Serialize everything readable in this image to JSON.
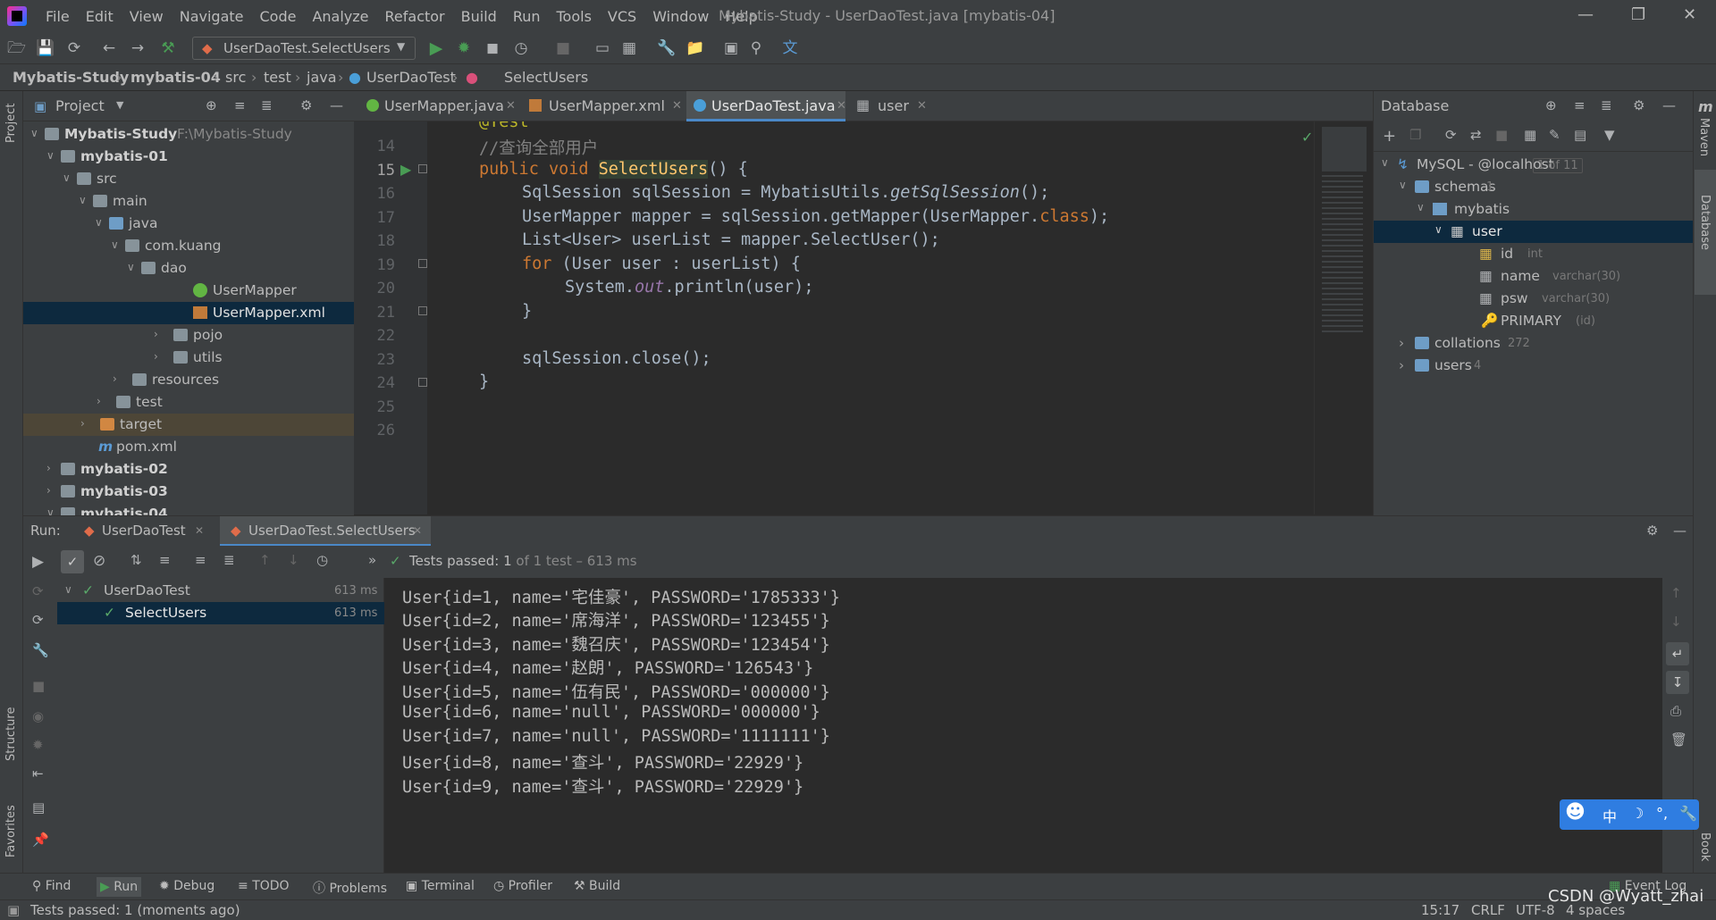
{
  "menubar": {
    "items": [
      "File",
      "Edit",
      "View",
      "Navigate",
      "Code",
      "Analyze",
      "Refactor",
      "Build",
      "Run",
      "Tools",
      "VCS",
      "Window",
      "Help"
    ],
    "title": "Mybatis-Study - UserDaoTest.java [mybatis-04]"
  },
  "toolbar": {
    "run_config": "UserDaoTest.SelectUsers"
  },
  "breadcrumb": [
    "Mybatis-Study",
    "mybatis-04",
    "src",
    "test",
    "java",
    "UserDaoTest",
    "SelectUsers"
  ],
  "project_panel": {
    "title": "Project",
    "tree": [
      {
        "label": "Mybatis-Study",
        "extra": "F:\\Mybatis-Study"
      },
      {
        "label": "mybatis-01"
      },
      {
        "label": "src"
      },
      {
        "label": "main"
      },
      {
        "label": "java"
      },
      {
        "label": "com.kuang"
      },
      {
        "label": "dao"
      },
      {
        "label": "UserMapper"
      },
      {
        "label": "UserMapper.xml"
      },
      {
        "label": "pojo"
      },
      {
        "label": "utils"
      },
      {
        "label": "resources"
      },
      {
        "label": "test"
      },
      {
        "label": "target"
      },
      {
        "label": "pom.xml"
      },
      {
        "label": "mybatis-02"
      },
      {
        "label": "mybatis-03"
      },
      {
        "label": "mybatis-04"
      }
    ]
  },
  "editor_tabs": [
    "UserMapper.java",
    "UserMapper.xml",
    "UserDaoTest.java",
    "user"
  ],
  "editor": {
    "line_numbers": [
      "14",
      "15",
      "16",
      "17",
      "18",
      "19",
      "20",
      "21",
      "22",
      "23",
      "24",
      "25",
      "26"
    ],
    "top_partial": "@Test",
    "line14": "//查询全部用户",
    "l15_kw": "public void ",
    "l15_fn": "SelectUsers",
    "l15_rest": "() {",
    "l16_a": "SqlSession sqlSession = MybatisUtils.",
    "l16_b": "getSqlSession",
    "l16_c": "();",
    "l17_a": "UserMapper mapper = sqlSession.getMapper(UserMapper.",
    "l17_b": "class",
    "l17_c": ");",
    "l18": "List<User> userList = mapper.SelectUser();",
    "l19_kw": "for",
    "l19_rest": " (User user : userList) {",
    "l20_a": "System.",
    "l20_b": "out",
    "l20_c": ".println(user);",
    "l21": "}",
    "l23": "sqlSession.close();",
    "l24": "}"
  },
  "database_panel": {
    "title": "Database",
    "connection": "MySQL - @localhost",
    "connection_count": "1 of 11",
    "schemas": "schemas",
    "schemas_count": "1",
    "schema": "mybatis",
    "table": "user",
    "columns": [
      {
        "name": "id",
        "type": "int"
      },
      {
        "name": "name",
        "type": "varchar(30)"
      },
      {
        "name": "psw",
        "type": "varchar(30)"
      }
    ],
    "key": "PRIMARY",
    "key_cols": "(id)",
    "collations": "collations",
    "collations_count": "272",
    "users": "users",
    "users_count": "4"
  },
  "run_panel": {
    "label": "Run:",
    "tabs": [
      "UserDaoTest",
      "UserDaoTest.SelectUsers"
    ],
    "status_prefix": "Tests passed:",
    "status_count": "1",
    "status_suffix": "of 1 test – 613 ms",
    "tests": [
      {
        "name": "UserDaoTest",
        "time": "613 ms"
      },
      {
        "name": "SelectUsers",
        "time": "613 ms"
      }
    ],
    "output": [
      "User{id=1, name='宅佳豪', PASSWORD='1785333'}",
      "User{id=2, name='席海洋', PASSWORD='123455'}",
      "User{id=3, name='魏召庆', PASSWORD='123454'}",
      "User{id=4, name='赵朗', PASSWORD='126543'}",
      "User{id=5, name='伍有民', PASSWORD='000000'}",
      "User{id=6, name='null', PASSWORD='000000'}",
      "User{id=7, name='null', PASSWORD='1111111'}",
      "User{id=8, name='查斗', PASSWORD='22929'}",
      "User{id=9, name='查斗', PASSWORD='22929'}"
    ]
  },
  "bottom_tabs": [
    "Find",
    "Run",
    "Debug",
    "TODO",
    "Problems",
    "Terminal",
    "Profiler",
    "Build",
    "Event Log"
  ],
  "left_stripe": [
    "Project",
    "Structure",
    "Favorites"
  ],
  "right_stripe": [
    "Maven",
    "Database",
    "Book"
  ],
  "status_bar": {
    "message": "Tests passed: 1 (moments ago)",
    "position": "15:17",
    "line_sep": "CRLF",
    "encoding": "UTF-8",
    "indent": "4 spaces"
  },
  "ime": {
    "lang": "中"
  },
  "watermark": "CSDN @Wyatt_zhai",
  "colors": {
    "accent": "#4a88c7",
    "pass": "#499c54",
    "selection": "#0d293e",
    "bg": "#2b2b2b",
    "panel": "#3c3f41"
  }
}
